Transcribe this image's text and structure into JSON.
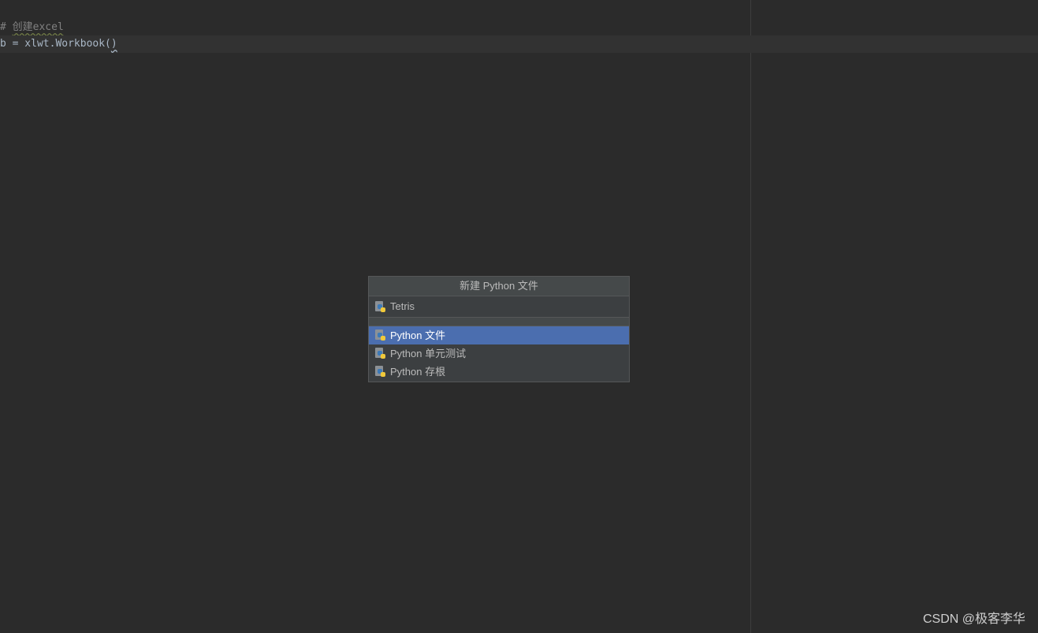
{
  "editor": {
    "comment_prefix": "# ",
    "comment_text": "创建excel",
    "code_prefix": "b = xlwt.Workbook(",
    "code_paren": ")"
  },
  "popup": {
    "title": "新建 Python 文件",
    "input_value": "Tetris",
    "items": [
      {
        "label": "Python 文件",
        "selected": true
      },
      {
        "label": "Python 单元测试",
        "selected": false
      },
      {
        "label": "Python 存根",
        "selected": false
      }
    ],
    "icon_name": "python-file-icon"
  },
  "watermark": "CSDN @极客李华",
  "colors": {
    "background": "#2b2b2b",
    "popup_bg": "#3c3f41",
    "selection": "#4b6eaf",
    "python_blue": "#3d7ab8",
    "python_yellow": "#f0c93a"
  }
}
